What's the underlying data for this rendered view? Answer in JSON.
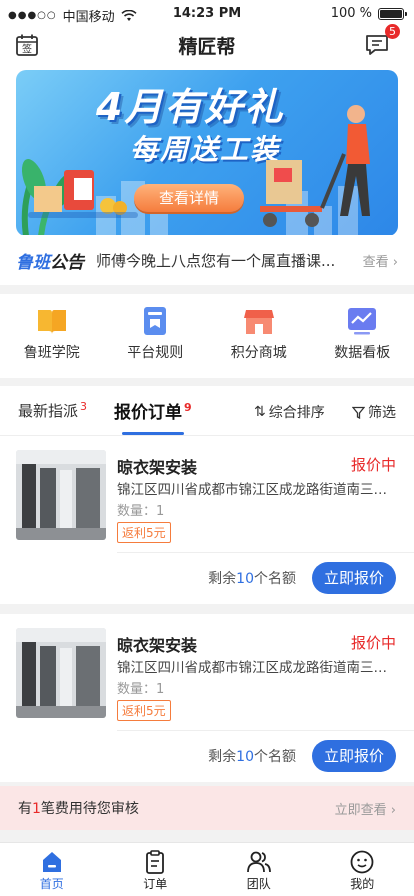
{
  "status_bar": {
    "carrier": "中国移动",
    "time": "14:23 PM",
    "battery": "100 %"
  },
  "nav": {
    "title": "精匠帮",
    "message_badge": "5"
  },
  "banner": {
    "title": "4月有好礼",
    "subtitle": "每周送工装",
    "button": "查看详情"
  },
  "notice": {
    "logo_part1": "鲁班",
    "logo_part2": "公告",
    "text": "师傅今晚上八点您有一个属直播课...",
    "more": "查看"
  },
  "quick_links": [
    {
      "label": "鲁班学院",
      "icon": "book-icon",
      "color": "#f5a623"
    },
    {
      "label": "平台规则",
      "icon": "rules-icon",
      "color": "#5b8def"
    },
    {
      "label": "积分商城",
      "icon": "store-icon",
      "color": "#f0604a"
    },
    {
      "label": "数据看板",
      "icon": "chart-board-icon",
      "color": "#6a7cf0"
    }
  ],
  "tabs": {
    "latest": "最新指派",
    "latest_count": "3",
    "quote": "报价订单",
    "quote_count": "9",
    "sort": "综合排序",
    "filter": "筛选"
  },
  "orders": [
    {
      "name": "晾衣架安装",
      "status": "报价中",
      "address": "锦江区四川省成都市锦江区成龙路街道南三环...",
      "qty": "数量：1",
      "rebate": "返利5元",
      "remain_prefix": "剩余",
      "remain_num": "10",
      "remain_suffix": "个名额",
      "button": "立即报价"
    },
    {
      "name": "晾衣架安装",
      "status": "报价中",
      "address": "锦江区四川省成都市锦江区成龙路街道南三环...",
      "qty": "数量：1",
      "rebate": "返利5元",
      "remain_prefix": "剩余",
      "remain_num": "10",
      "remain_suffix": "个名额",
      "button": "立即报价"
    }
  ],
  "fee_bar": {
    "prefix": "有",
    "count": "1",
    "suffix": "笔费用待您审核",
    "action": "立即查看"
  },
  "tabbar": [
    {
      "label": "首页",
      "icon": "home-icon"
    },
    {
      "label": "订单",
      "icon": "order-icon"
    },
    {
      "label": "团队",
      "icon": "team-icon"
    },
    {
      "label": "我的",
      "icon": "profile-icon"
    }
  ],
  "colors": {
    "primary": "#2f6fe0",
    "alert": "#e82a2a",
    "accent": "#f57c3d"
  }
}
